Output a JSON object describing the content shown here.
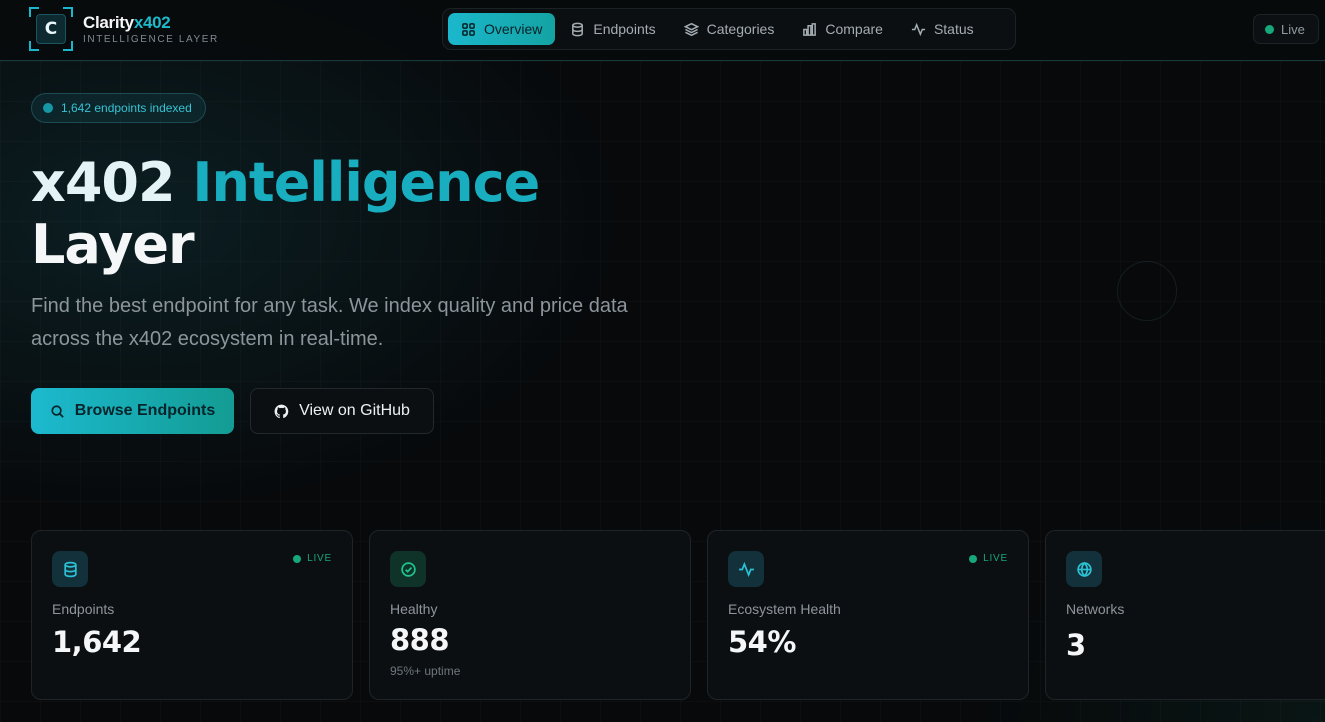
{
  "brand": {
    "name_main": "Clarity",
    "name_accent": "x402",
    "tagline": "INTELLIGENCE LAYER",
    "mark_letter": "C"
  },
  "nav": {
    "items": [
      {
        "label": "Overview",
        "icon": "grid-icon",
        "active": true
      },
      {
        "label": "Endpoints",
        "icon": "database-icon",
        "active": false
      },
      {
        "label": "Categories",
        "icon": "layers-icon",
        "active": false
      },
      {
        "label": "Compare",
        "icon": "bar-chart-icon",
        "active": false
      },
      {
        "label": "Status",
        "icon": "activity-icon",
        "active": false
      }
    ]
  },
  "status_pill": {
    "label": "Live",
    "color": "#16a77a"
  },
  "hero": {
    "badge": "1,642 endpoints indexed",
    "title_part1": "x402 ",
    "title_part2": "Intelligence",
    "title_line2": "Layer",
    "description": "Find the best endpoint for any task. We index quality and price data across the x402 ecosystem in real-time.",
    "primary_button": "Browse Endpoints",
    "secondary_button": "View on GitHub"
  },
  "stats": [
    {
      "label": "Endpoints",
      "value": "1,642",
      "live": "LIVE",
      "sub": "",
      "icon": "database-icon",
      "icon_color": "#2cc1d4",
      "icon_bg": "#10323a"
    },
    {
      "label": "Healthy",
      "value": "888",
      "live": "",
      "sub": "95%+ uptime",
      "icon": "check-circle-icon",
      "icon_color": "#1fc48f",
      "icon_bg": "#0f3329"
    },
    {
      "label": "Ecosystem Health",
      "value": "54%",
      "live": "LIVE",
      "sub": "",
      "icon": "activity-icon",
      "icon_color": "#2cc1d4",
      "icon_bg": "#10323a"
    },
    {
      "label": "Networks",
      "value": "3",
      "live": "",
      "sub": "",
      "icon": "globe-icon",
      "icon_color": "#2cc1d4",
      "icon_bg": "#10323a"
    }
  ],
  "colors": {
    "accent": "#1bb7cc",
    "accent_green": "#139c93",
    "live_green": "#16a77a",
    "background": "#07090b"
  }
}
